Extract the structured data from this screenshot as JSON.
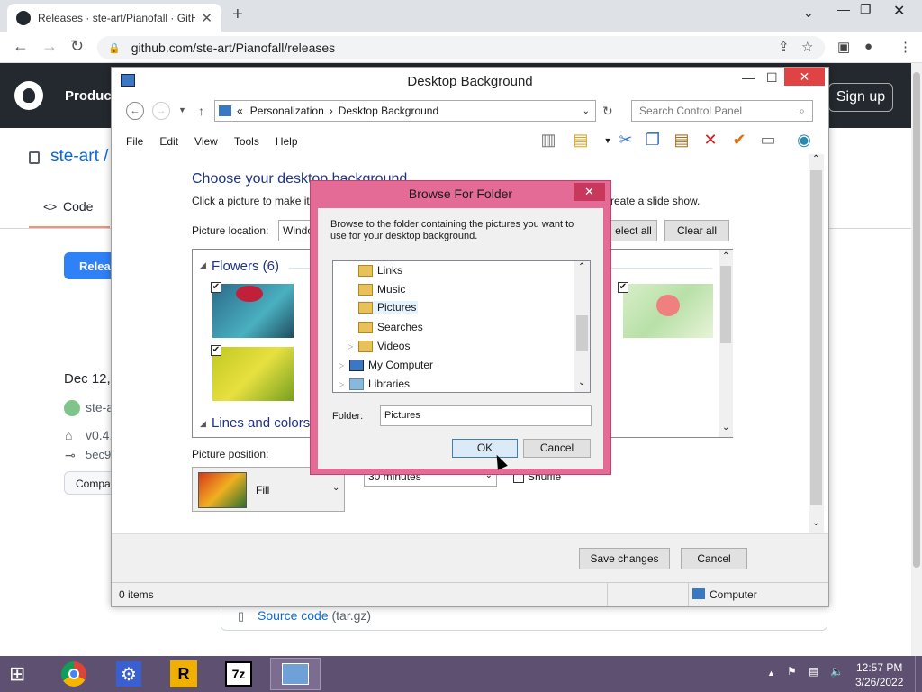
{
  "browser": {
    "tab_title": "Releases · ste-art/Pianofall · GitH",
    "tab_close": "✕",
    "new_tab": "+",
    "url": "github.com/ste-art/Pianofall/releases"
  },
  "github": {
    "products": "Produc",
    "signup": "Sign up",
    "repo": "ste-art /",
    "code_tab": "Code",
    "release_btn": "Relea",
    "date": "Dec 12,",
    "author": "ste-a",
    "tag": "v0.4.",
    "commit": "5ec9",
    "compare": "Compa",
    "source_code": "Source code",
    "source_ext": "(tar.gz)"
  },
  "desktop_bg": {
    "title": "Desktop Background",
    "breadcrumb_prefix": "«",
    "breadcrumb_1": "Personalization",
    "breadcrumb_sep": "›",
    "breadcrumb_2": "Desktop Background",
    "search_placeholder": "Search Control Panel",
    "menus": [
      "File",
      "Edit",
      "View",
      "Tools",
      "Help"
    ],
    "heading": "Choose your desktop background",
    "subtext": "Click a picture to make it",
    "subtext_right": "reate a slide show.",
    "picture_location_label": "Picture location:",
    "picture_location_value": "Windo",
    "select_all": "elect all",
    "clear_all": "Clear all",
    "group_flowers": "Flowers (6)",
    "group_lines": "Lines and colors",
    "picture_position_label": "Picture position:",
    "picture_position_value": "Fill",
    "interval_value": "30 minutes",
    "shuffle_label": "Shuffle",
    "save_changes": "Save changes",
    "cancel": "Cancel",
    "status_items": "0 items",
    "status_location": "Computer"
  },
  "browse_folder": {
    "title": "Browse For Folder",
    "close": "✕",
    "description": "Browse to the folder containing the pictures you want to use for your desktop background.",
    "tree": [
      "Links",
      "Music",
      "Pictures",
      "Searches",
      "Videos",
      "My Computer",
      "Libraries"
    ],
    "selected": "Pictures",
    "folder_label": "Folder:",
    "folder_value": "Pictures",
    "ok": "OK",
    "cancel": "Cancel"
  },
  "taskbar": {
    "time": "12:57 PM",
    "date": "3/26/2022"
  },
  "colors": {
    "dialog_frame": "#e46b96",
    "taskbar": "#5e5070",
    "github_header": "#24292f"
  }
}
